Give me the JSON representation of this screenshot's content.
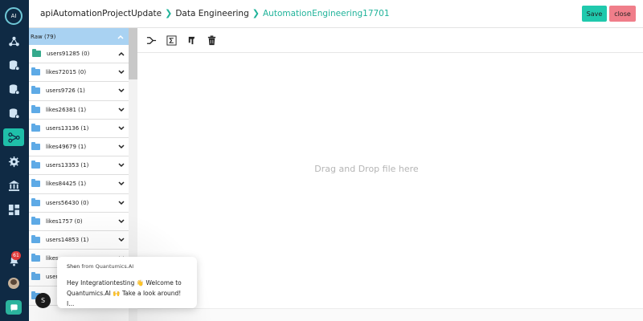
{
  "logo": {
    "text": "AI"
  },
  "header": {
    "breadcrumb": [
      "apiAutomationProjectUpdate",
      "Data Engineering",
      "AutomationEngineering17701"
    ],
    "save_label": "Save",
    "close_label": "close"
  },
  "colors": {
    "accent": "#20c9ad",
    "rail": "#0f2a44",
    "close": "#f07e8a",
    "tree_root": "#a9d2f2"
  },
  "notifications": {
    "count": "61"
  },
  "tree": {
    "root_label": "Raw (79)",
    "items": [
      {
        "label": "users91285 (0)",
        "expanded": true
      },
      {
        "label": "likes72015 (0)"
      },
      {
        "label": "users9726 (1)"
      },
      {
        "label": "likes26381 (1)"
      },
      {
        "label": "users13136 (1)"
      },
      {
        "label": "likes49679 (1)"
      },
      {
        "label": "users13353 (1)"
      },
      {
        "label": "likes84425 (1)"
      },
      {
        "label": "users56430 (0)"
      },
      {
        "label": "likes1757 (0)"
      },
      {
        "label": "users14853 (1)"
      },
      {
        "label": "likes"
      },
      {
        "label": "user"
      },
      {
        "label": ""
      }
    ]
  },
  "toolbar": {
    "icons": [
      "scissors-icon",
      "sigma-icon",
      "python-icon",
      "trash-icon"
    ]
  },
  "canvas": {
    "dropzone_text": "Drag and Drop file here"
  },
  "chat": {
    "sender": "Shen",
    "from_text": "from Quantumics.AI",
    "message": "Hey Integrationtesting 👋 Welcome to Quantumics.AI 🙌 Take a look around! I...",
    "avatar_letter": "S"
  }
}
